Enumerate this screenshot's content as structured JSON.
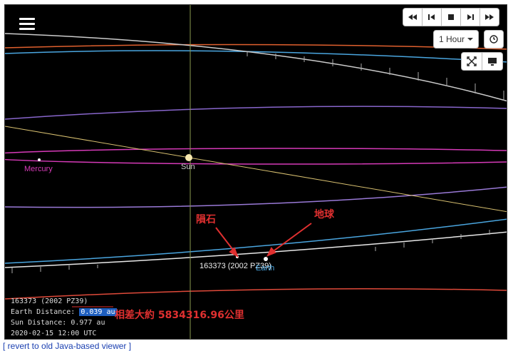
{
  "controls": {
    "rewind_icon": "fast-rewind-icon",
    "step_back_icon": "step-back-icon",
    "stop_icon": "stop-icon",
    "step_forward_icon": "step-forward-icon",
    "fast_forward_icon": "fast-forward-icon",
    "speed_label": "1 Hour",
    "clock_icon": "clock-icon",
    "fullscreen_icon": "fullscreen-icon",
    "display_icon": "monitor-icon",
    "menu_icon": "hamburger-menu-icon"
  },
  "bodies": {
    "sun_label": "Sun",
    "mercury_label": "Mercury",
    "asteroid_label": "163373 (2002 PZ39)",
    "earth_label": "Earth"
  },
  "info": {
    "object_name": "163373 (2002 PZ39)",
    "earth_distance_label": "Earth Distance:",
    "earth_distance_value": "0.039 au",
    "sun_distance_label": "Sun Distance:",
    "sun_distance_value": "0.977 au",
    "timestamp": "2020-02-15 12:00 UTC"
  },
  "annotations": {
    "meteor": "隕石",
    "earth": "地球",
    "distance_note": "相差大約 5834316.96公里"
  },
  "footer": {
    "revert_link": "[ revert to old Java-based viewer ]"
  },
  "colors": {
    "mercury": "#d63ab8",
    "earth_orbit": "#4aa6e0",
    "mars_orbit": "#e04a3a",
    "venus_orbit": "#9a7ad8",
    "annotation": "#e03030",
    "highlight": "#1f5fbf"
  }
}
